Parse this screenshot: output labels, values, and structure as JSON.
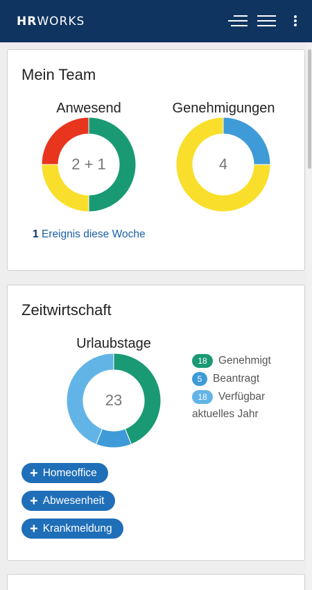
{
  "header": {
    "logo_bold": "HR",
    "logo_regular": "WORKS",
    "colors": {
      "bar": "#0f3460",
      "icons": "#ffffff"
    },
    "icons": [
      "align-right-menu-icon",
      "hamburger-menu-icon",
      "more-vertical-icon"
    ]
  },
  "team": {
    "title": "Mein Team",
    "present": {
      "label": "Anwesend",
      "center": "2 + 1",
      "segments": [
        {
          "value": 2,
          "color": "#1a9a74"
        },
        {
          "value": 1,
          "color": "#f9df2c"
        },
        {
          "value": 1,
          "color": "#e8351e"
        }
      ]
    },
    "approvals": {
      "label": "Genehmigungen",
      "center": "4",
      "segments": [
        {
          "value": 1,
          "color": "#3e9bd8"
        },
        {
          "value": 3,
          "color": "#f9df2c"
        }
      ]
    },
    "events": {
      "count": "1",
      "label": "Ereignis diese Woche"
    }
  },
  "time": {
    "title": "Zeitwirtschaft",
    "vacation": {
      "label": "Urlaubstage",
      "center": "23",
      "segments": [
        {
          "value": 18,
          "color": "#1a9a74"
        },
        {
          "value": 5,
          "color": "#3e9bd8"
        },
        {
          "value": 18,
          "color": "#63b4e6"
        }
      ]
    },
    "legend": [
      {
        "count": "18",
        "label": "Genehmigt",
        "color": "#1a9a74"
      },
      {
        "count": "5",
        "label": "Beantragt",
        "color": "#3e9bd8"
      },
      {
        "count": "18",
        "label": "Verfügbar",
        "color": "#63b4e6"
      }
    ],
    "legend_extra": "aktuelles Jahr",
    "actions": [
      {
        "icon": "+",
        "label": "Homeoffice"
      },
      {
        "icon": "+",
        "label": "Abwesenheit"
      },
      {
        "icon": "+",
        "label": "Krankmeldung"
      }
    ]
  }
}
